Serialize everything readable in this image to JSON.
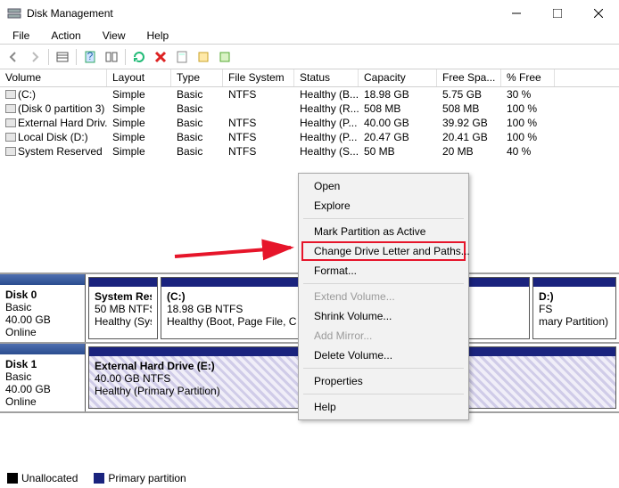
{
  "window": {
    "title": "Disk Management"
  },
  "menu": [
    "File",
    "Action",
    "View",
    "Help"
  ],
  "columns": [
    "Volume",
    "Layout",
    "Type",
    "File System",
    "Status",
    "Capacity",
    "Free Spa...",
    "% Free"
  ],
  "volumes": [
    {
      "name": "(C:)",
      "layout": "Simple",
      "type": "Basic",
      "fs": "NTFS",
      "status": "Healthy (B...",
      "capacity": "18.98 GB",
      "free": "5.75 GB",
      "pct": "30 %"
    },
    {
      "name": "(Disk 0 partition 3)",
      "layout": "Simple",
      "type": "Basic",
      "fs": "",
      "status": "Healthy (R...",
      "capacity": "508 MB",
      "free": "508 MB",
      "pct": "100 %"
    },
    {
      "name": "External Hard Driv...",
      "layout": "Simple",
      "type": "Basic",
      "fs": "NTFS",
      "status": "Healthy (P...",
      "capacity": "40.00 GB",
      "free": "39.92 GB",
      "pct": "100 %"
    },
    {
      "name": "Local Disk (D:)",
      "layout": "Simple",
      "type": "Basic",
      "fs": "NTFS",
      "status": "Healthy (P...",
      "capacity": "20.47 GB",
      "free": "20.41 GB",
      "pct": "100 %"
    },
    {
      "name": "System Reserved",
      "layout": "Simple",
      "type": "Basic",
      "fs": "NTFS",
      "status": "Healthy (S...",
      "capacity": "50 MB",
      "free": "20 MB",
      "pct": "40 %"
    }
  ],
  "disk0": {
    "label": "Disk 0",
    "kind": "Basic",
    "size": "40.00 GB",
    "state": "Online",
    "parts": [
      {
        "title": "System Res",
        "l2": "50 MB NTFS",
        "l3": "Healthy (Sys"
      },
      {
        "title": "(C:)",
        "l2": "18.98 GB NTFS",
        "l3": "Healthy (Boot, Page File, C"
      },
      {
        "title": "D:)",
        "l2": "FS",
        "l3": "mary Partition)"
      }
    ]
  },
  "disk1": {
    "label": "Disk 1",
    "kind": "Basic",
    "size": "40.00 GB",
    "state": "Online",
    "parts": [
      {
        "title": "External Hard Drive  (E:)",
        "l2": "40.00 GB NTFS",
        "l3": "Healthy (Primary Partition)"
      }
    ]
  },
  "legend": {
    "unallocated": "Unallocated",
    "primary": "Primary partition"
  },
  "context": {
    "open": "Open",
    "explore": "Explore",
    "mark": "Mark Partition as Active",
    "change": "Change Drive Letter and Paths...",
    "format": "Format...",
    "extend": "Extend Volume...",
    "shrink": "Shrink Volume...",
    "mirror": "Add Mirror...",
    "delete": "Delete Volume...",
    "props": "Properties",
    "help": "Help"
  }
}
